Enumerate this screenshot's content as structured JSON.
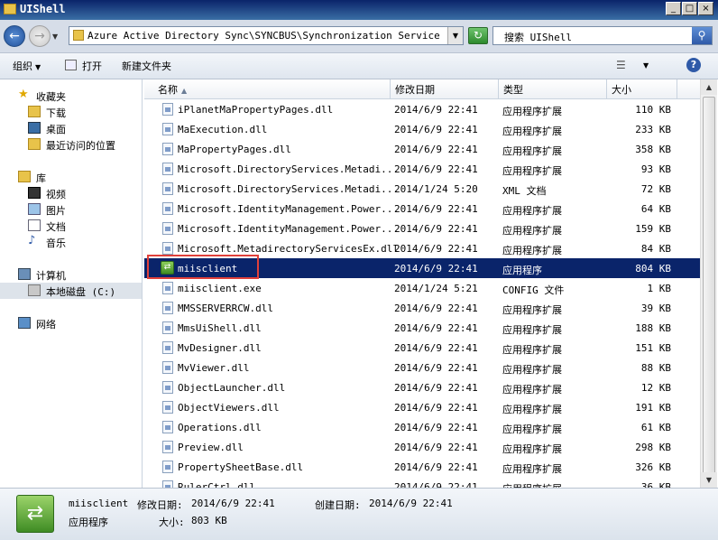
{
  "window": {
    "title": "UIShell"
  },
  "address": {
    "path": "Azure Active Directory Sync\\SYNCBUS\\Synchronization Service\\UIShell",
    "search_placeholder": "搜索 UIShell"
  },
  "toolbar": {
    "organize": "组织",
    "open": "打开",
    "new_folder": "新建文件夹"
  },
  "nav": {
    "favorites": "收藏夹",
    "downloads": "下载",
    "desktop": "桌面",
    "recent": "最近访问的位置",
    "libraries": "库",
    "videos": "视频",
    "pictures": "图片",
    "documents": "文档",
    "music": "音乐",
    "computer": "计算机",
    "local_disk": "本地磁盘 (C:)",
    "network": "网络"
  },
  "columns": {
    "name": "名称",
    "date": "修改日期",
    "type": "类型",
    "size": "大小"
  },
  "files": [
    {
      "name": "iPlanetMaPropertyPages.dll",
      "date": "2014/6/9 22:41",
      "type": "应用程序扩展",
      "size": "110 KB"
    },
    {
      "name": "MaExecution.dll",
      "date": "2014/6/9 22:41",
      "type": "应用程序扩展",
      "size": "233 KB"
    },
    {
      "name": "MaPropertyPages.dll",
      "date": "2014/6/9 22:41",
      "type": "应用程序扩展",
      "size": "358 KB"
    },
    {
      "name": "Microsoft.DirectoryServices.Metadi...",
      "date": "2014/6/9 22:41",
      "type": "应用程序扩展",
      "size": "93 KB"
    },
    {
      "name": "Microsoft.DirectoryServices.Metadi...",
      "date": "2014/1/24 5:20",
      "type": "XML 文档",
      "size": "72 KB"
    },
    {
      "name": "Microsoft.IdentityManagement.Power...",
      "date": "2014/6/9 22:41",
      "type": "应用程序扩展",
      "size": "64 KB"
    },
    {
      "name": "Microsoft.IdentityManagement.Power...",
      "date": "2014/6/9 22:41",
      "type": "应用程序扩展",
      "size": "159 KB"
    },
    {
      "name": "Microsoft.MetadirectoryServicesEx.dll",
      "date": "2014/6/9 22:41",
      "type": "应用程序扩展",
      "size": "84 KB"
    },
    {
      "name": "miisclient",
      "date": "2014/6/9 22:41",
      "type": "应用程序",
      "size": "804 KB"
    },
    {
      "name": "miisclient.exe",
      "date": "2014/1/24 5:21",
      "type": "CONFIG 文件",
      "size": "1 KB"
    },
    {
      "name": "MMSSERVERRCW.dll",
      "date": "2014/6/9 22:41",
      "type": "应用程序扩展",
      "size": "39 KB"
    },
    {
      "name": "MmsUiShell.dll",
      "date": "2014/6/9 22:41",
      "type": "应用程序扩展",
      "size": "188 KB"
    },
    {
      "name": "MvDesigner.dll",
      "date": "2014/6/9 22:41",
      "type": "应用程序扩展",
      "size": "151 KB"
    },
    {
      "name": "MvViewer.dll",
      "date": "2014/6/9 22:41",
      "type": "应用程序扩展",
      "size": "88 KB"
    },
    {
      "name": "ObjectLauncher.dll",
      "date": "2014/6/9 22:41",
      "type": "应用程序扩展",
      "size": "12 KB"
    },
    {
      "name": "ObjectViewers.dll",
      "date": "2014/6/9 22:41",
      "type": "应用程序扩展",
      "size": "191 KB"
    },
    {
      "name": "Operations.dll",
      "date": "2014/6/9 22:41",
      "type": "应用程序扩展",
      "size": "61 KB"
    },
    {
      "name": "Preview.dll",
      "date": "2014/6/9 22:41",
      "type": "应用程序扩展",
      "size": "298 KB"
    },
    {
      "name": "PropertySheetBase.dll",
      "date": "2014/6/9 22:41",
      "type": "应用程序扩展",
      "size": "326 KB"
    },
    {
      "name": "RulerCtrl.dll",
      "date": "2014/6/9 22:41",
      "type": "应用程序扩展",
      "size": "36 KB"
    }
  ],
  "selected_index": 8,
  "details": {
    "name": "miisclient",
    "modified_label": "修改日期:",
    "modified": "2014/6/9 22:41",
    "created_label": "创建日期:",
    "created": "2014/6/9 22:41",
    "type": "应用程序",
    "size_label": "大小:",
    "size": "803 KB"
  },
  "colors": {
    "selection": "#0a246a",
    "highlight_box": "#e0403a"
  }
}
